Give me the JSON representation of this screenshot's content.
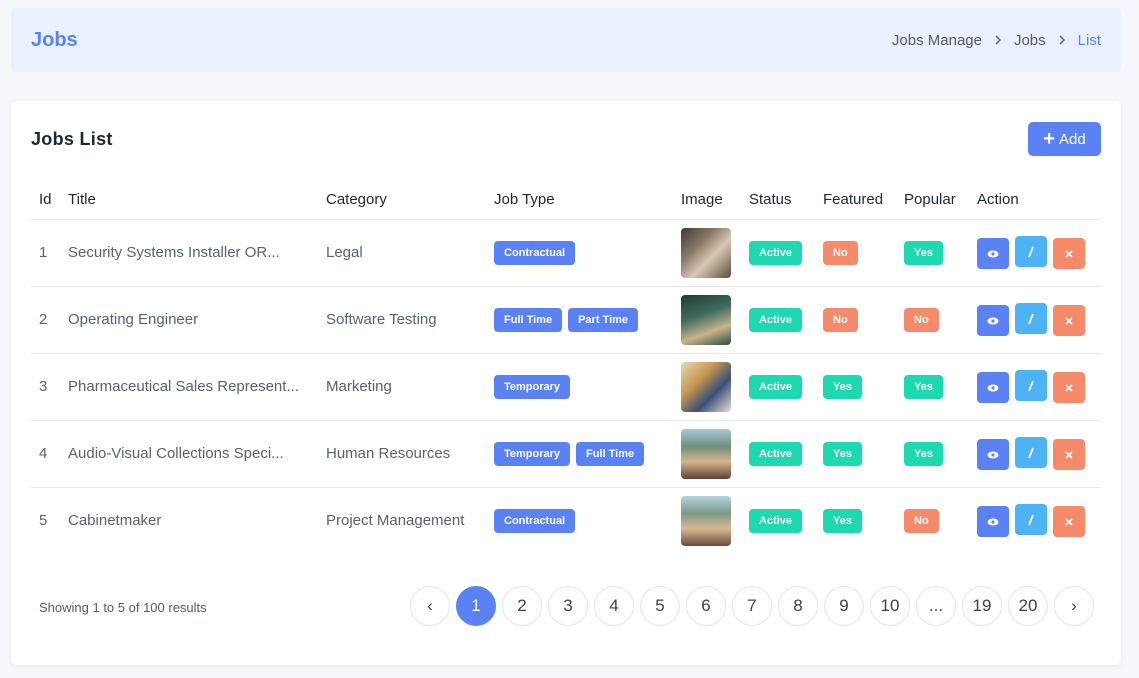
{
  "header": {
    "title": "Jobs",
    "breadcrumb": [
      "Jobs Manage",
      "Jobs",
      "List"
    ]
  },
  "card": {
    "title": "Jobs List",
    "add_label": "Add"
  },
  "table": {
    "columns": [
      "Id",
      "Title",
      "Category",
      "Job Type",
      "Image",
      "Status",
      "Featured",
      "Popular",
      "Action"
    ],
    "rows": [
      {
        "id": "1",
        "title": "Security Systems Installer OR...",
        "category": "Legal",
        "types": [
          "Contractual"
        ],
        "status": "Active",
        "featured": "No",
        "popular": "Yes"
      },
      {
        "id": "2",
        "title": "Operating Engineer",
        "category": "Software Testing",
        "types": [
          "Full Time",
          "Part Time"
        ],
        "status": "Active",
        "featured": "No",
        "popular": "No"
      },
      {
        "id": "3",
        "title": "Pharmaceutical Sales Represent...",
        "category": "Marketing",
        "types": [
          "Temporary"
        ],
        "status": "Active",
        "featured": "Yes",
        "popular": "Yes"
      },
      {
        "id": "4",
        "title": "Audio-Visual Collections Speci...",
        "category": "Human Resources",
        "types": [
          "Temporary",
          "Full Time"
        ],
        "status": "Active",
        "featured": "Yes",
        "popular": "Yes"
      },
      {
        "id": "5",
        "title": "Cabinetmaker",
        "category": "Project Management",
        "types": [
          "Contractual"
        ],
        "status": "Active",
        "featured": "Yes",
        "popular": "No"
      }
    ]
  },
  "pagination": {
    "showing": "Showing 1 to 5 of 100 results",
    "prev": "‹",
    "next": "›",
    "pages": [
      "1",
      "2",
      "3",
      "4",
      "5",
      "6",
      "7",
      "8",
      "9",
      "10",
      "...",
      "19",
      "20"
    ],
    "current": "1"
  },
  "colors": {
    "primary": "#5b82f5",
    "success": "#1dd9b0",
    "danger": "#f58b6a",
    "info": "#4db3f5"
  }
}
